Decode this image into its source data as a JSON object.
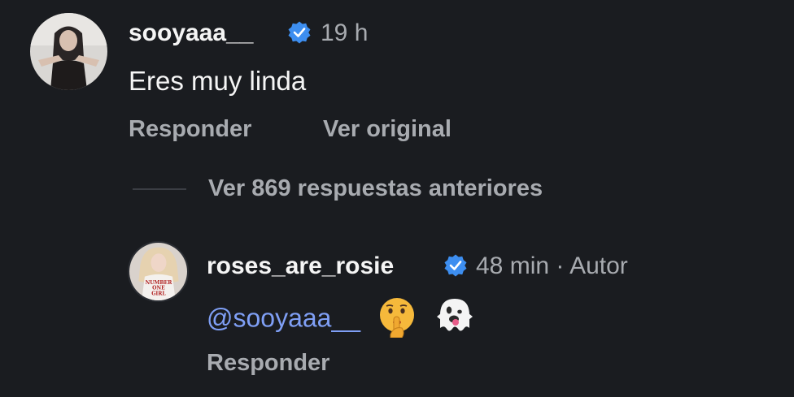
{
  "comment": {
    "username": "sooyaaa__",
    "verified_icon": "verified-badge-icon",
    "time": "19 h",
    "text": "Eres muy linda",
    "reply_label": "Responder",
    "see_original_label": "Ver original"
  },
  "thread": {
    "view_previous_label": "Ver 869 respuestas anteriores"
  },
  "reply": {
    "username": "roses_are_rosie",
    "verified_icon": "verified-badge-icon",
    "time": "48 min",
    "separator": "·",
    "author_label": "Autor",
    "mention": "@sooyaaa__",
    "emojis": [
      "shushing-face-emoji",
      "ghost-emoji"
    ],
    "reply_label": "Responder",
    "avatar_shirt_text": [
      "NUMBER",
      "ONE",
      "GIRL"
    ]
  },
  "colors": {
    "background": "#1a1c20",
    "text": "#f5f5f5",
    "secondary": "#a8abb0",
    "mention": "#7f9ff5",
    "verified": "#3d8ef0"
  }
}
